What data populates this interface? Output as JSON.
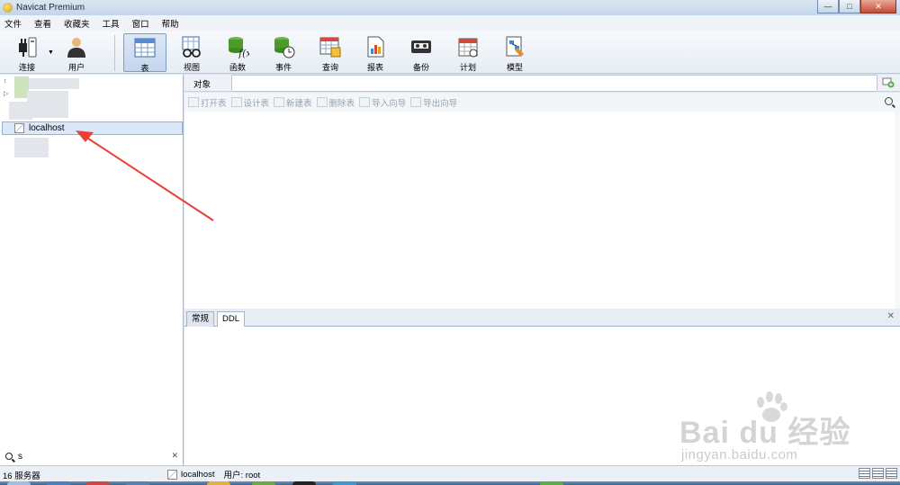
{
  "window": {
    "title": "Navicat Premium"
  },
  "menu": [
    "文件",
    "查看",
    "收藏夹",
    "工具",
    "窗口",
    "帮助"
  ],
  "toolbar": {
    "connect": "连接",
    "user": "用户",
    "table": "表",
    "view": "视图",
    "function": "函数",
    "event": "事件",
    "query": "查询",
    "report": "报表",
    "backup": "备份",
    "schedule": "计划",
    "model": "模型"
  },
  "tree": {
    "selected_connection": "localhost"
  },
  "search": {
    "value": "s"
  },
  "object_tab": {
    "label": "对象"
  },
  "actions": {
    "open_table": "打开表",
    "design_table": "设计表",
    "new_table": "新建表",
    "delete_table": "删除表",
    "import_wizard": "导入向导",
    "export_wizard": "导出向导"
  },
  "detail_tabs": {
    "general": "常规",
    "ddl": "DDL"
  },
  "status": {
    "server_count": "16 服务器",
    "connection": "localhost",
    "user": "用户: root"
  },
  "watermark": {
    "brand": "Bai du 经验",
    "url": "jingyan.baidu.com"
  },
  "colors": {
    "accent": "#3d6592",
    "annotation": "#e8413a"
  }
}
